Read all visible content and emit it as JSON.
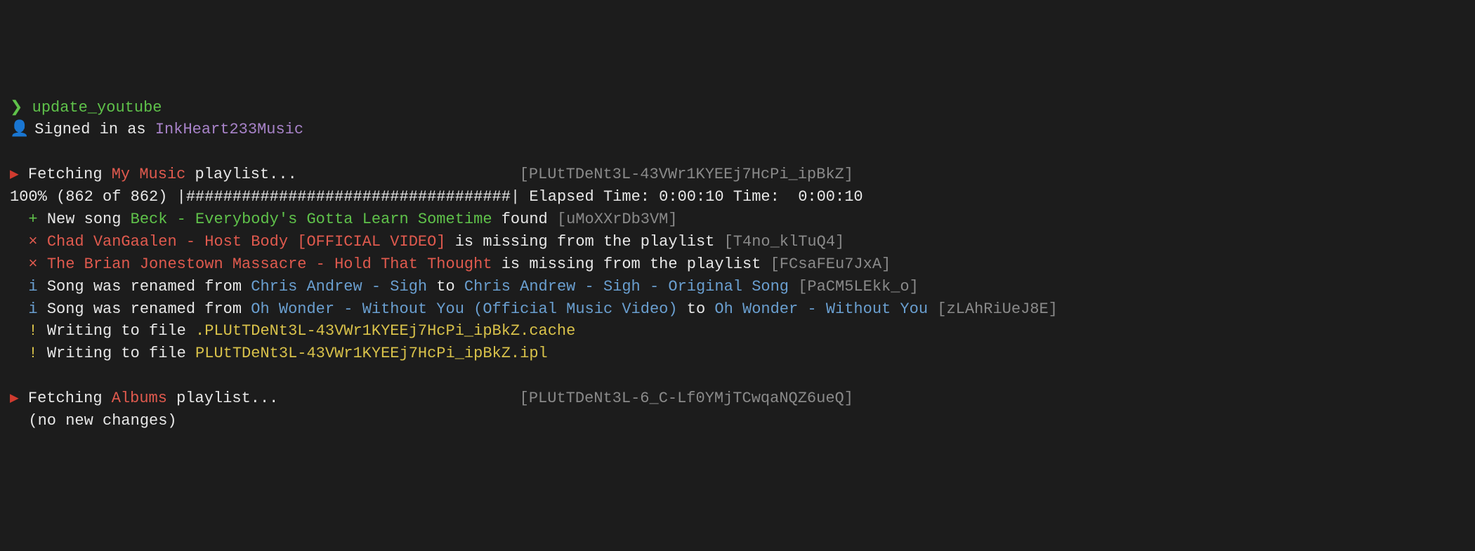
{
  "prompt": {
    "symbol": "❯",
    "command": "update_youtube"
  },
  "signin": {
    "icon": "👤",
    "prefix": "Signed in as ",
    "username": "InkHeart233Music"
  },
  "sections": [
    {
      "header": {
        "marker": "▶",
        "prefix": "Fetching ",
        "name": "My Music",
        "suffix": " playlist...",
        "pad": "                        ",
        "id": "[PLUtTDeNt3L-43VWr1KYEEj7HcPi_ipBkZ]"
      },
      "progress": {
        "percent": "100%",
        "counts_a": " (862 of 862) |",
        "bar": "###################################",
        "tail": "| Elapsed Time: 0:00:10 Time:  0:00:10"
      },
      "lines": [
        {
          "marker": "+",
          "marker_class": "green",
          "segments": [
            {
              "text": "New song ",
              "class": "white"
            },
            {
              "text": "Beck - Everybody's Gotta Learn Sometime",
              "class": "green"
            },
            {
              "text": " found ",
              "class": "white"
            },
            {
              "text": "[uMoXXrDb3VM]",
              "class": "grey"
            }
          ]
        },
        {
          "marker": "×",
          "marker_class": "red",
          "segments": [
            {
              "text": "Chad VanGaalen - Host Body [OFFICIAL VIDEO]",
              "class": "red"
            },
            {
              "text": " is missing from the playlist ",
              "class": "white"
            },
            {
              "text": "[T4no_klTuQ4]",
              "class": "grey"
            }
          ]
        },
        {
          "marker": "×",
          "marker_class": "red",
          "segments": [
            {
              "text": "The Brian Jonestown Massacre - Hold That Thought",
              "class": "red"
            },
            {
              "text": " is missing from the playlist ",
              "class": "white"
            },
            {
              "text": "[FCsaFEu7JxA]",
              "class": "grey"
            }
          ]
        },
        {
          "marker": "i",
          "marker_class": "blue",
          "segments": [
            {
              "text": "Song was renamed from ",
              "class": "white"
            },
            {
              "text": "Chris Andrew - Sigh",
              "class": "blue"
            },
            {
              "text": " to ",
              "class": "white"
            },
            {
              "text": "Chris Andrew - Sigh - Original Song",
              "class": "blue"
            },
            {
              "text": " ",
              "class": "white"
            },
            {
              "text": "[PaCM5LEkk_o]",
              "class": "grey"
            }
          ]
        },
        {
          "marker": "i",
          "marker_class": "blue",
          "segments": [
            {
              "text": "Song was renamed from ",
              "class": "white"
            },
            {
              "text": "Oh Wonder - Without You (Official Music Video)",
              "class": "blue"
            },
            {
              "text": " to ",
              "class": "white"
            },
            {
              "text": "Oh Wonder - Without You",
              "class": "blue"
            },
            {
              "text": " ",
              "class": "white"
            },
            {
              "text": "[zLAhRiUeJ8E]",
              "class": "grey"
            }
          ]
        },
        {
          "marker": "!",
          "marker_class": "yellow",
          "segments": [
            {
              "text": "Writing to file ",
              "class": "white"
            },
            {
              "text": ".PLUtTDeNt3L-43VWr1KYEEj7HcPi_ipBkZ.cache",
              "class": "yellow"
            }
          ]
        },
        {
          "marker": "!",
          "marker_class": "yellow",
          "segments": [
            {
              "text": "Writing to file ",
              "class": "white"
            },
            {
              "text": "PLUtTDeNt3L-43VWr1KYEEj7HcPi_ipBkZ.ipl",
              "class": "yellow"
            }
          ]
        }
      ]
    },
    {
      "header": {
        "marker": "▶",
        "prefix": "Fetching ",
        "name": "Albums",
        "suffix": " playlist...",
        "pad": "                          ",
        "id": "[PLUtTDeNt3L-6_C-Lf0YMjTCwqaNQZ6ueQ]"
      },
      "note": "  (no new changes)"
    }
  ]
}
